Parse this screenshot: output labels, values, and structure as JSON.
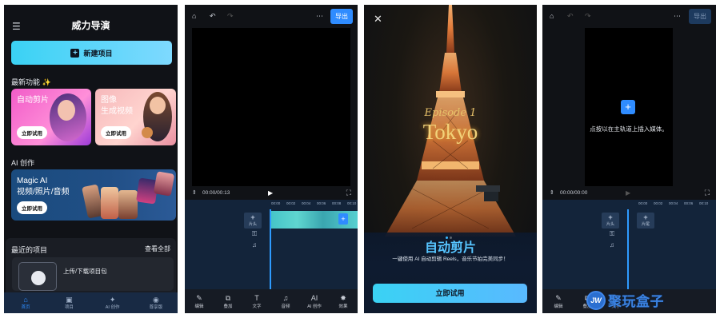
{
  "home": {
    "menu_icon": "hamburger-icon",
    "title": "威力导演",
    "new_project": "新建项目",
    "latest_label": "最新功能 ✨",
    "cards": [
      {
        "title": "自动剪片",
        "try": "立即试用"
      },
      {
        "title": "图像\n生成视频",
        "try": "立即试用"
      }
    ],
    "ai_label": "AI 创作",
    "ai_card": {
      "title": "Magic AI\n视频/照片/音频",
      "try": "立即试用"
    },
    "recent": {
      "title": "最近的项目",
      "view_all": "查看全部",
      "upload": "上传/下载项目包"
    },
    "tabs": [
      {
        "icon": "home-icon",
        "label": "首页",
        "active": true
      },
      {
        "icon": "projects-icon",
        "label": "项目",
        "active": false
      },
      {
        "icon": "ai-icon",
        "label": "AI 创作",
        "active": false
      },
      {
        "icon": "subscription-icon",
        "label": "尊享版",
        "active": false
      }
    ]
  },
  "editor1": {
    "export": "导出",
    "time": "00:00/00:13",
    "ruler": [
      "00:00",
      "00:02",
      "00:04",
      "00:06",
      "00:08",
      "00:10"
    ],
    "add_label": "片头",
    "tools": [
      {
        "icon": "edit-icon",
        "label": "编辑"
      },
      {
        "icon": "overlay-icon",
        "label": "叠加"
      },
      {
        "icon": "text-icon",
        "label": "文字"
      },
      {
        "icon": "music-icon",
        "label": "音频"
      },
      {
        "icon": "ai-icon",
        "label": "AI 创作"
      },
      {
        "icon": "effects-icon",
        "label": "效果"
      }
    ]
  },
  "promo": {
    "episode": "Episode 1",
    "city": "Tokyo",
    "title": "自动剪片",
    "desc": "一键使用 AI 自动剪辑 Reels，音乐节拍完美同步！",
    "try": "立即试用"
  },
  "editor2": {
    "export": "导出",
    "hint": "点按以在主轨道上插入媒体。",
    "time": "00:00/00:00",
    "ruler": [
      "00:00",
      "00:02",
      "00:04",
      "00:06",
      "00:08",
      "00:10"
    ],
    "add_label": "片尾",
    "tools": [
      {
        "icon": "edit-icon",
        "label": "编辑"
      },
      {
        "icon": "overlay-icon",
        "label": "叠加"
      },
      {
        "icon": "text-icon",
        "label": "文字"
      }
    ]
  },
  "watermark": {
    "logo": "JW",
    "text": "聚玩盒子"
  }
}
